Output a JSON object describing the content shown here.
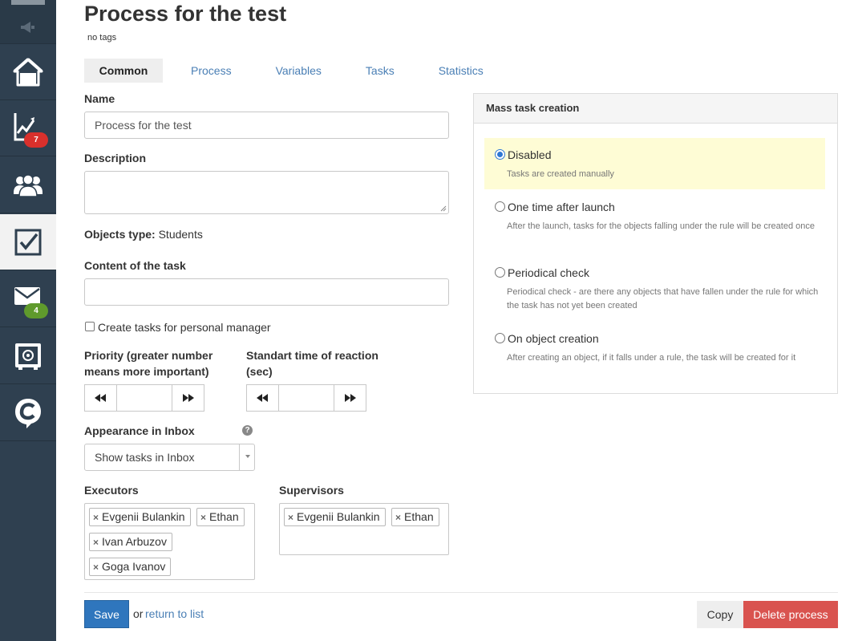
{
  "sidebar": {
    "badges": {
      "deals": "7",
      "mail": "4"
    },
    "items": [
      {
        "icon": "home-icon"
      },
      {
        "icon": "chart-icon"
      },
      {
        "icon": "users-icon"
      },
      {
        "icon": "tasks-icon"
      },
      {
        "icon": "mail-icon"
      },
      {
        "icon": "safe-icon"
      },
      {
        "icon": "chat-logo-icon"
      }
    ]
  },
  "header": {
    "title": "Process for the test",
    "tags": "no tags"
  },
  "tabs": [
    "Common",
    "Process",
    "Variables",
    "Tasks",
    "Statistics"
  ],
  "form": {
    "name_label": "Name",
    "name_value": "Process for the test",
    "description_label": "Description",
    "objects_type_label": "Objects type",
    "objects_type_sep": ":",
    "objects_type_value": " Students",
    "content_label": "Content of the task",
    "personal_manager_label": "Create tasks for personal manager",
    "priority_label_1": "Priority (greater number",
    "priority_label_2": "means more important)",
    "reaction_label_1": "Standart time of reaction",
    "reaction_label_2": "(sec)",
    "inbox_label": "Appearance in Inbox",
    "inbox_help": "?",
    "inbox_value": "Show tasks in Inbox",
    "executors_label": "Executors",
    "executors": [
      "Evgenii Bulankin",
      "Ethan",
      "Ivan Arbuzov",
      "Goga Ivanov"
    ],
    "supervisors_label": "Supervisors",
    "supervisors": [
      "Evgenii Bulankin",
      "Ethan"
    ],
    "chip_remove": "×"
  },
  "mass_task": {
    "title": "Mass task creation",
    "options": [
      {
        "label": "Disabled",
        "desc": "Tasks are created manually",
        "selected": true
      },
      {
        "label": "One time after launch",
        "desc": "After the launch, tasks for the objects falling under the rule will be created once",
        "selected": false
      },
      {
        "label": "Periodical check",
        "desc": "Periodical check - are there any objects that have fallen under the rule for which the task has not yet been created",
        "selected": false
      },
      {
        "label": "On object creation",
        "desc": "After creating an object, if it falls under a rule, the task will be created for it",
        "selected": false
      }
    ]
  },
  "footer": {
    "save": "Save",
    "or": "or",
    "return": "return to list",
    "copy": "Copy",
    "delete": "Delete process"
  },
  "colors": {
    "sidebar": "#2f4050",
    "accent": "#2f76bd",
    "danger": "#d9534f",
    "highlight": "#fefcd5"
  }
}
